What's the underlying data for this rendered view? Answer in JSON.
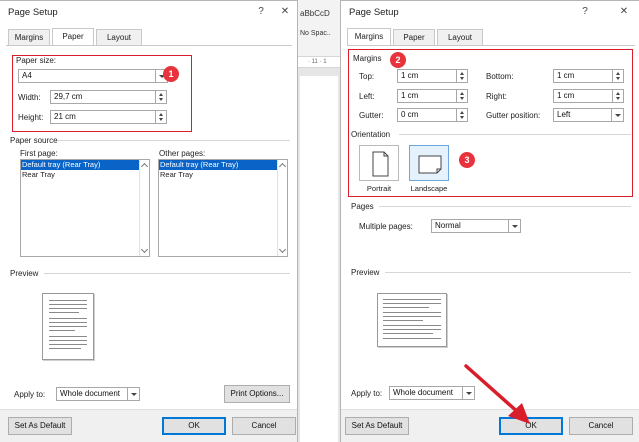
{
  "background_app": {
    "ribbon_style_preview": "aBbCcD",
    "ribbon_style_name": "No Spac..",
    "ruler_text": "· 11 · 1"
  },
  "left_dialog": {
    "title": "Page Setup",
    "help_glyph": "?",
    "close_glyph": "✕",
    "tabs": [
      {
        "label": "Margins",
        "active": false
      },
      {
        "label": "Paper",
        "active": true
      },
      {
        "label": "Layout",
        "active": false
      }
    ],
    "paper_size": {
      "section_label": "Paper size:",
      "selected": "A4",
      "width_label": "Width:",
      "width_value": "29,7 cm",
      "height_label": "Height:",
      "height_value": "21 cm"
    },
    "paper_source": {
      "section_label": "Paper source",
      "first_page_label": "First page:",
      "first_page_items": [
        "Default tray (Rear Tray)",
        "Rear Tray"
      ],
      "other_pages_label": "Other pages:",
      "other_pages_items": [
        "Default tray (Rear Tray)",
        "Rear Tray"
      ]
    },
    "preview_label": "Preview",
    "apply_to_label": "Apply to:",
    "apply_to_value": "Whole document",
    "print_options_button": "Print Options...",
    "set_as_default_button": "Set As Default",
    "ok_button": "OK",
    "cancel_button": "Cancel",
    "badge_number": "1"
  },
  "right_dialog": {
    "title": "Page Setup",
    "help_glyph": "?",
    "close_glyph": "✕",
    "tabs": [
      {
        "label": "Margins",
        "active": true
      },
      {
        "label": "Paper",
        "active": false
      },
      {
        "label": "Layout",
        "active": false
      }
    ],
    "margins": {
      "section_label": "Margins",
      "top_label": "Top:",
      "top_value": "1 cm",
      "bottom_label": "Bottom:",
      "bottom_value": "1 cm",
      "left_label": "Left:",
      "left_value": "1 cm",
      "right_label": "Right:",
      "right_value": "1 cm",
      "gutter_label": "Gutter:",
      "gutter_value": "0 cm",
      "gutter_position_label": "Gutter position:",
      "gutter_position_value": "Left"
    },
    "orientation": {
      "section_label": "Orientation",
      "portrait_label": "Portrait",
      "landscape_label": "Landscape",
      "selected": "Landscape"
    },
    "pages": {
      "section_label": "Pages",
      "multiple_pages_label": "Multiple pages:",
      "multiple_pages_value": "Normal"
    },
    "preview_label": "Preview",
    "apply_to_label": "Apply to:",
    "apply_to_value": "Whole document",
    "set_as_default_button": "Set As Default",
    "ok_button": "OK",
    "cancel_button": "Cancel",
    "badge_margins": "2",
    "badge_orientation": "3"
  },
  "colors": {
    "annotation_red": "#d81e2b",
    "badge_red": "#e8323c",
    "selection_blue": "#0a64c8",
    "primary_button_border": "#0078d7"
  }
}
